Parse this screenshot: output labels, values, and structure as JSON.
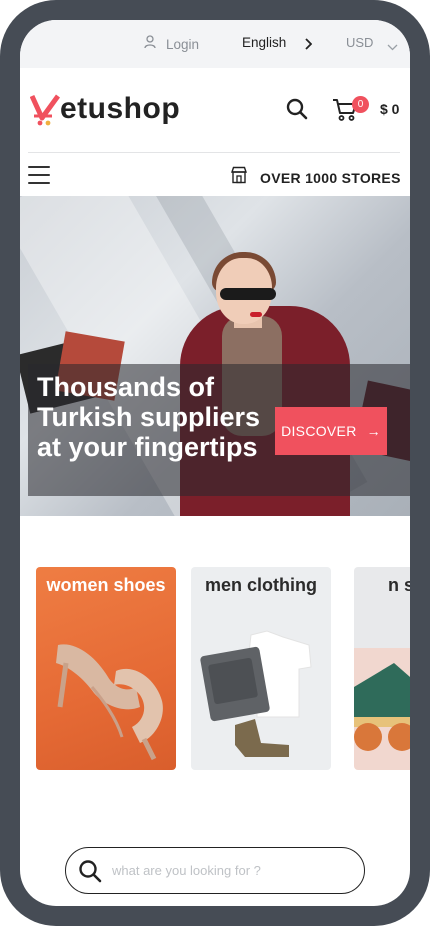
{
  "topbar": {
    "login_label": "Login",
    "language": "English",
    "currency": "USD"
  },
  "header": {
    "logo_text": "etushop",
    "cart_count": "0",
    "cart_total": "$ 0"
  },
  "nav": {
    "stores_label": "OVER 1000 STORES"
  },
  "hero": {
    "headline": "Thousands of Turkish suppliers at your fingertips",
    "cta_label": "DISCOVER",
    "cta_arrow": "→"
  },
  "categories": [
    {
      "title": "women shoes"
    },
    {
      "title": "men clothing"
    },
    {
      "title": "n sh"
    }
  ],
  "search": {
    "placeholder": "what are you looking for ?"
  },
  "colors": {
    "accent": "#f0515e",
    "frame": "#464c55",
    "text": "#222222"
  },
  "icons": [
    "user-icon",
    "chevron-right-icon",
    "chevron-down-icon",
    "search-icon",
    "cart-icon",
    "menu-icon",
    "store-icon",
    "arrow-right-icon"
  ]
}
